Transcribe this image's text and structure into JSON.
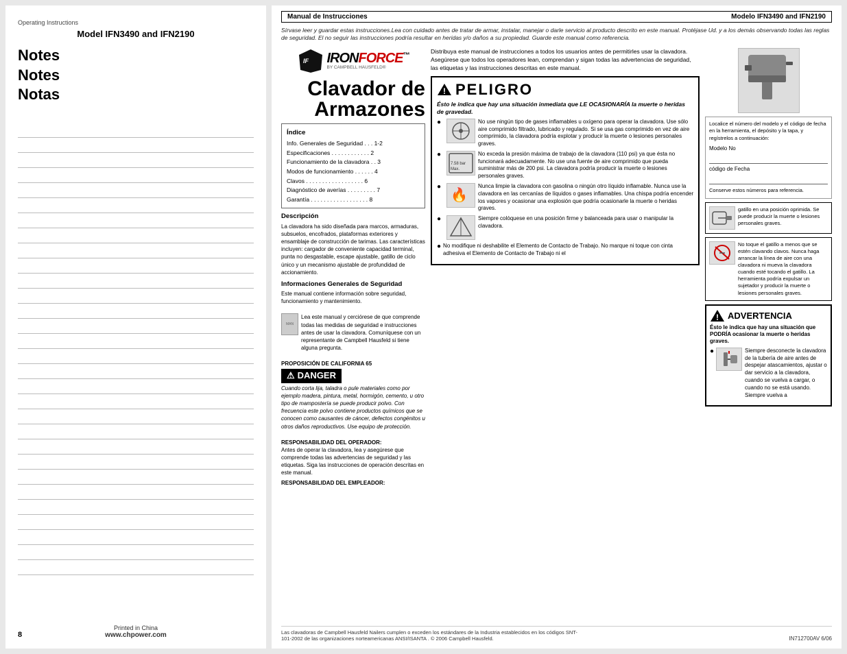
{
  "left_page": {
    "top_label": "Operating Instructions",
    "model_title": "Model IFN3490 and IFN2190",
    "notes": [
      "Notes",
      "Notes",
      "Notas"
    ],
    "page_number": "8",
    "footer_printed": "Printed in China",
    "footer_website": "www.chpower.com"
  },
  "right_page": {
    "header_bar": {
      "left": "Manual de Instrucciones",
      "right": "Modelo IFN3490 and IFN2190"
    },
    "disclaimer": "Sírvase leer y guardar estas instrucciones.Lea con cuidado antes de tratar de armar, instalar, manejar o darle servicio al producto descrito en este manual. Protéjase Ud. y a los demás observando todas las reglas de seguridad. El no seguir las instrucciones podría resultar en heridas y/o daños a su propiedad. Guarde este manual como referencia.",
    "logo": {
      "iron": "IRON",
      "force": "FORCE",
      "tm": "™",
      "by": "BY CAMPBELL HAUSFELD®"
    },
    "product_title": {
      "line1": "Clavador de",
      "line2": "Armazones"
    },
    "index": {
      "title": "Índice",
      "items": [
        "Info. Generales de Seguridad . . . 1-2",
        "Especificaciones  . . . . . . . . . . . . 2",
        "Funcionamiento de la clavadora  . . 3",
        "Modos de funcionamiento  . . . . . . 4",
        "Clavos  . . . . . . . . . . . . . . . . . . 6",
        "Diagnóstico de averías . . . . . . . . . 7",
        "Garantía  . . . . . . . . . . . . . . . . . . 8"
      ]
    },
    "descripcion": {
      "title": "Descripción",
      "text": "La clavadora ha sido diseñada para marcos, armaduras, subsuelos, encofrados, plataformas exteriores y ensamblaje de construcción de tarimas. Las características incluyen: cargador de conveniente capacidad terminal, punta no desgastable, escape ajustable, gatillo de ciclo único y un mecanismo ajustable de profundidad de accionamiento."
    },
    "info_general": {
      "title": "Informaciones Generales de Seguridad",
      "para1": "Este manual contiene información sobre seguridad, funcionamiento y mantenimiento.",
      "para2": "Lea este manual y cerciórese de que comprende todas las medidas de seguridad e instrucciones antes de usar la clavadora. Comuníquese con un representante de Campbell Hausfeld si tiene alguna pregunta.",
      "proposicion_title": "PROPOSICIÓN DE CALIFORNIA 65",
      "danger_banner": "DANGER",
      "danger_text": "Cuando corta lija, taladra o pule materiales como por ejemplo madera, pintura, metal, hormigón, cemento, u otro tipo de mampostería se puede producir polvo. Con frecuencia este polvo contiene productos químicos que se conocen como causantes de cáncer, defectos congénitos u otros daños reproductivos. Use equipo de protección.",
      "responsabilidad_operador": "RESPONSABILIDAD DEL OPERADOR:",
      "resp_op_text": "Antes de operar la clavadora, lea y asegúrese que comprende todas las advertencias de seguridad y las etiquetas. Siga las instrucciones de operación descritas en este manual.",
      "responsabilidad_empleador": "RESPONSABILIDAD DEL EMPLEADOR:"
    },
    "distribution_text": "Distribuya este manual de instrucciones a todos los usuarios antes de permitirles usar la clavadora. Asegúrese que todos los operadores lean, comprendan y sigan todas las advertencias de seguridad, las etiquetas y las instrucciones descritas en este manual.",
    "peligro": {
      "banner": "APELIGRO",
      "word": "PELIGRO",
      "subtitle": "Ésto le indica que hay una situación inmediata que LE OCASIONARÍA la muerte o heridas de gravedad.",
      "bullets": [
        {
          "bold": "No use ningún tipo de gases inflamables u oxígeno para operar la clavadora. Use sólo aire comprimido filtrado, lubricado y regulado. Si se usa gas comprimido en vez de aire comprimido, la clavadora podría explotar y producir la muerte o lesiones personales graves."
        },
        {
          "bold": "No exceda la presión máxima de trabajo de la clavadora (110 psi) ya que ésta no funcionará adecuadamente. No use una fuente de aire comprimido que pueda suministrar más de 200 psi. La clavadora podría producir la muerte o lesiones personales graves."
        },
        {
          "bold": "Nunca limpie la clavadora con gasolina o ningún otro líquido inflamable. Nunca use la clavadora en las cercanías de líquidos o gases inflamables. Una chispa podría encender los vapores y ocasionar una explosión que podría ocasionarle la muerte o heridas graves."
        },
        {
          "bold": "Siempre colóquese en una posición firme y balanceada para usar o manipular la clavadora."
        },
        {
          "bold": "No modifique ni deshabilite el Elemento de Contacto de Trabajo. No marque ni toque con cinta adhesiva el Elemento de Contacto de Trabajo ni el"
        }
      ]
    },
    "right_col": {
      "nail_gun_caption": "[nail gun image]",
      "model_info": {
        "label": "Localice el número del modelo y el código de fecha en la herramienta, el depósito y la tapa, y regístrelos a continuación:",
        "modelo_label": "Modelo No",
        "codigo_label": "código de Fecha",
        "conserve": "Conserve estos números para referencia."
      },
      "warning_items": [
        {
          "title": "gatillo en una posición oprimida. Se puede producir la muerte o lesiones personales graves."
        },
        {
          "title": "No toque el gatillo a menos que se estén clavando clavos. Nunca haga arrancar la línea de aire con una clavadora ni mueva la clavadora cuando esté tocando el gatillo. La herramienta podría expulsar un sujetador y producir la muerte o lesiones personales graves."
        }
      ],
      "advertencia": {
        "word": "ADVERTENCIA",
        "indicates": "Ésto le indica que hay una situación que PODRÍA ocasionar la muerte o heridas graves.",
        "bullets": [
          "Siempre desconecte la clavadora de la tubería de aire antes de despejar atascamientos, ajustar o dar servicio a la clavadora, cuando se vuelva a cargar, o cuando no se está usando. Siempre vuelva a"
        ]
      }
    },
    "footer": {
      "left_text": "Las clavadoras de Campbell Hausfeld Nailers cumplen o exceden los estándares de la Industria establecidos en los códigos SNT-101-2002 de las organizaciones norteamericanas ANSI/ISANTA . © 2006 Campbell Hausfeld.",
      "right_text": "IN712700AV  6/06"
    }
  }
}
